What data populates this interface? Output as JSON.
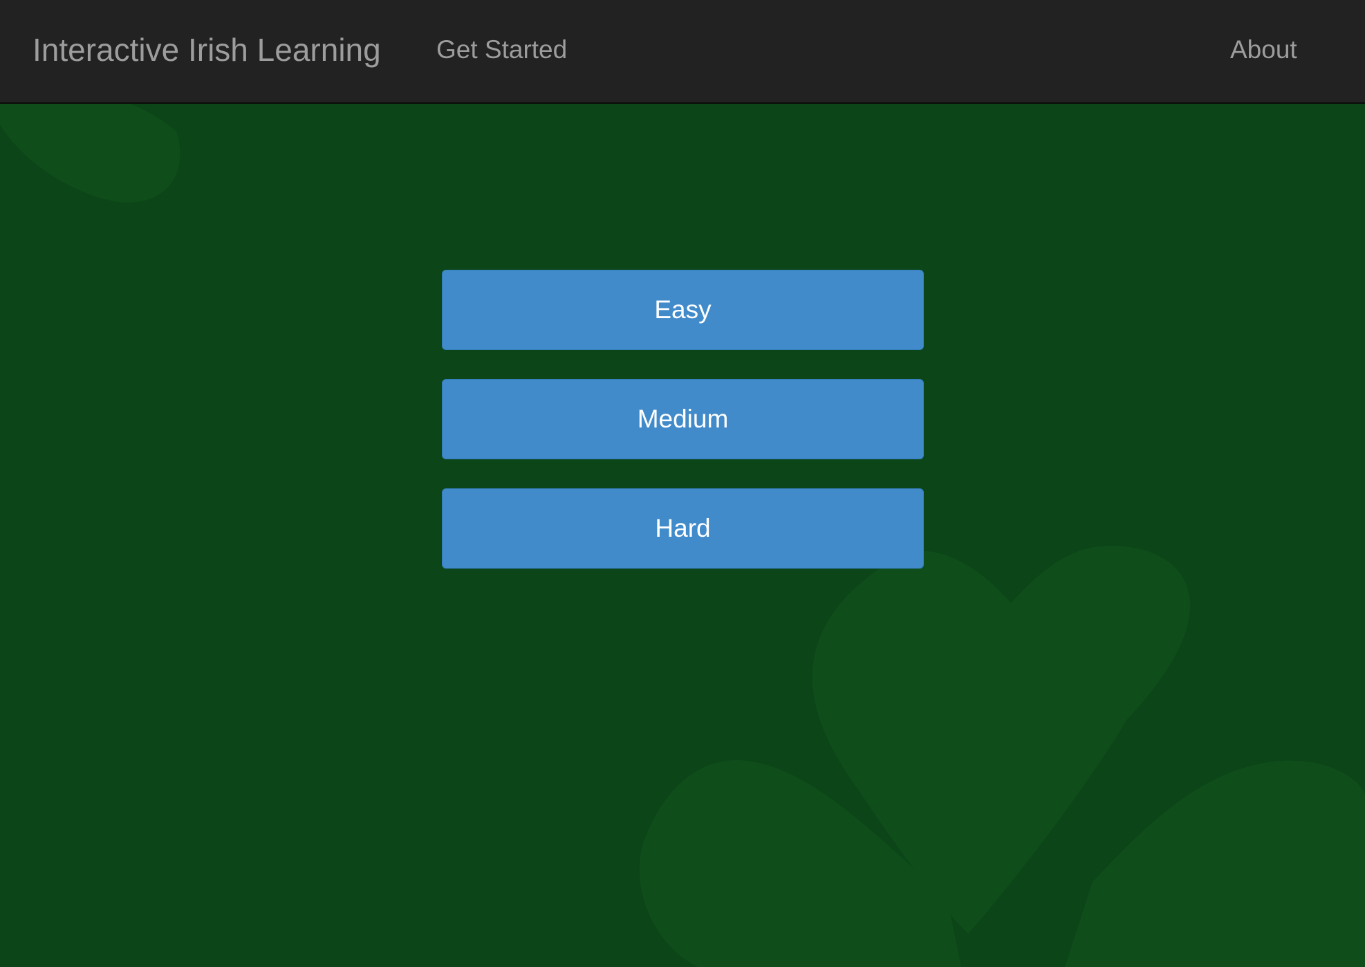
{
  "navbar": {
    "brand": "Interactive Irish Learning",
    "links": {
      "get_started": "Get Started",
      "about": "About"
    }
  },
  "levels": {
    "easy": "Easy",
    "medium": "Medium",
    "hard": "Hard"
  },
  "background": {
    "decoration": "shamrock-icon"
  },
  "colors": {
    "navbar": "#222222",
    "nav_text": "#9d9d9d",
    "background": "#0b4518",
    "shamrock": "#0f4e1b",
    "button": "#428bca",
    "button_text": "#ffffff"
  }
}
